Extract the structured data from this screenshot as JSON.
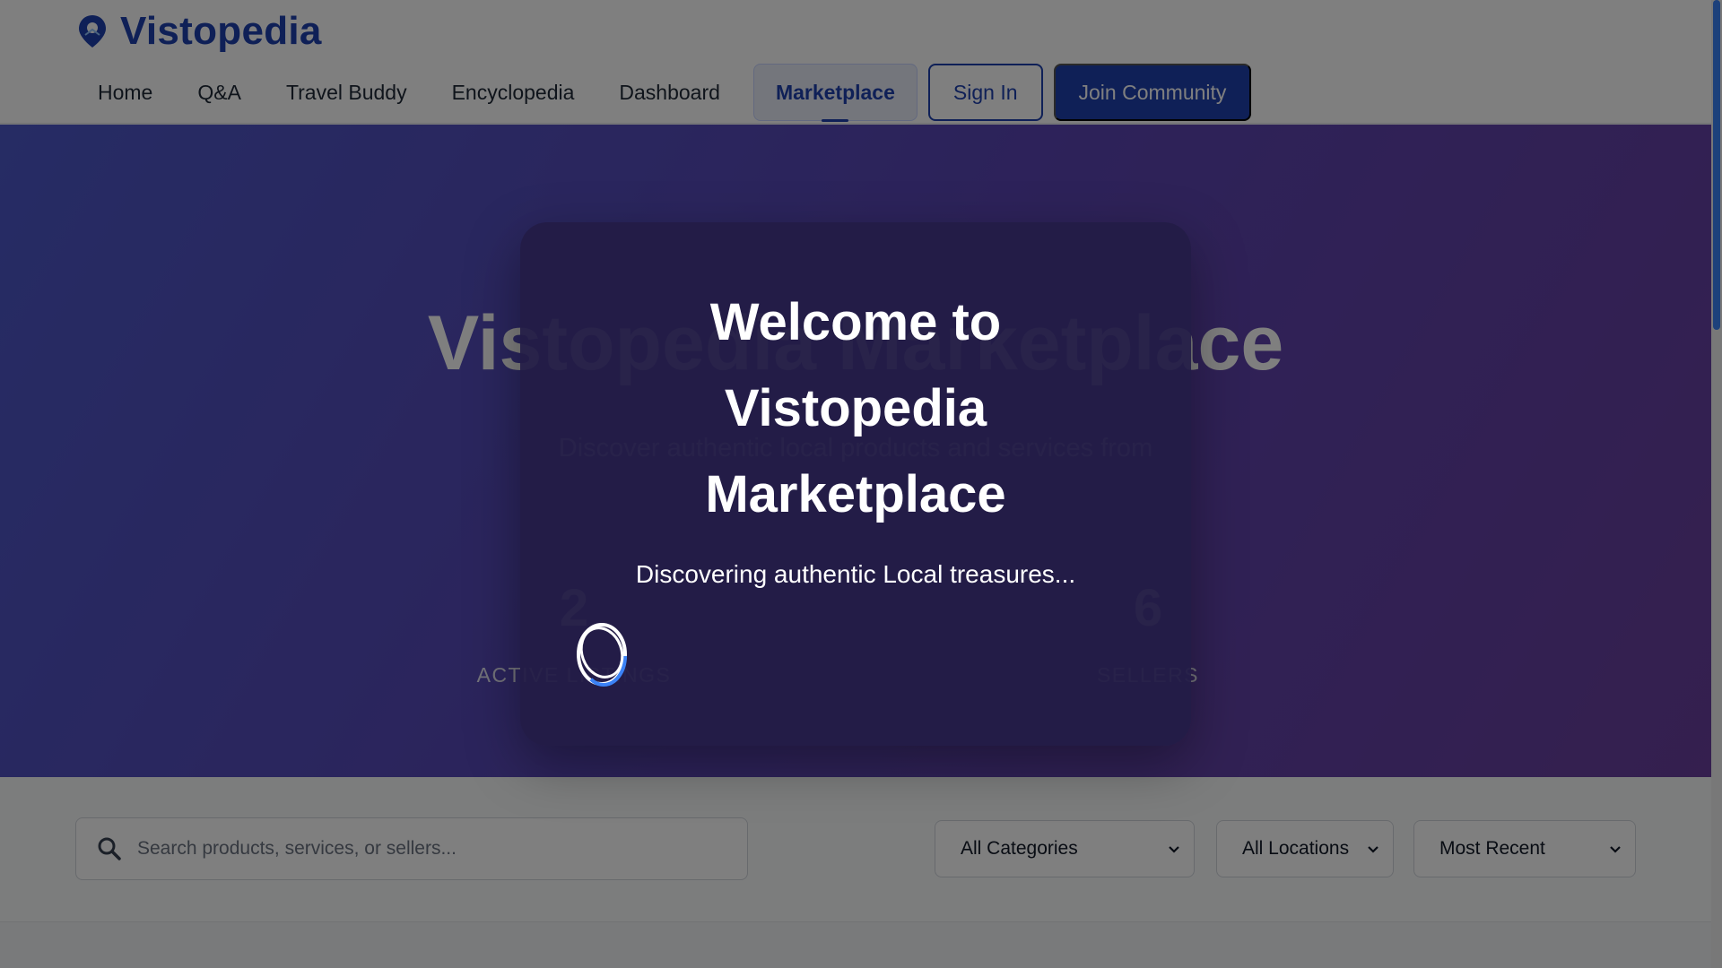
{
  "brand": {
    "name": "Vistopedia",
    "icon": "map-pin-icon"
  },
  "nav": {
    "items": [
      {
        "label": "Home"
      },
      {
        "label": "Q&A"
      },
      {
        "label": "Travel Buddy"
      },
      {
        "label": "Encyclopedia"
      },
      {
        "label": "Dashboard"
      },
      {
        "label": "Marketplace",
        "active": true
      }
    ],
    "sign_in": "Sign In",
    "join": "Join Community"
  },
  "hero": {
    "title": "Vistopedia Marketplace",
    "subtitle": "Discover authentic local products and services from",
    "stats": [
      {
        "value": "2",
        "label": "ACTIVE LISTINGS"
      },
      {
        "value": "",
        "label": ""
      },
      {
        "value": "6",
        "label": "SELLERS"
      }
    ]
  },
  "filters": {
    "search_placeholder": "Search products, services, or sellers...",
    "category": "All Categories",
    "location": "All Locations",
    "sort": "Most Recent"
  },
  "modal": {
    "title_line1": "Welcome to",
    "title_line2": "Vistopedia",
    "title_line3": "Marketplace",
    "subtitle": "Discovering authentic Local treasures..."
  },
  "colors": {
    "brand": "#1e40af",
    "hero_start": "#4c58c9",
    "hero_end": "#6a3f9e",
    "modal_bg": "#221c46",
    "scroll_thumb": "#3b82f6"
  }
}
